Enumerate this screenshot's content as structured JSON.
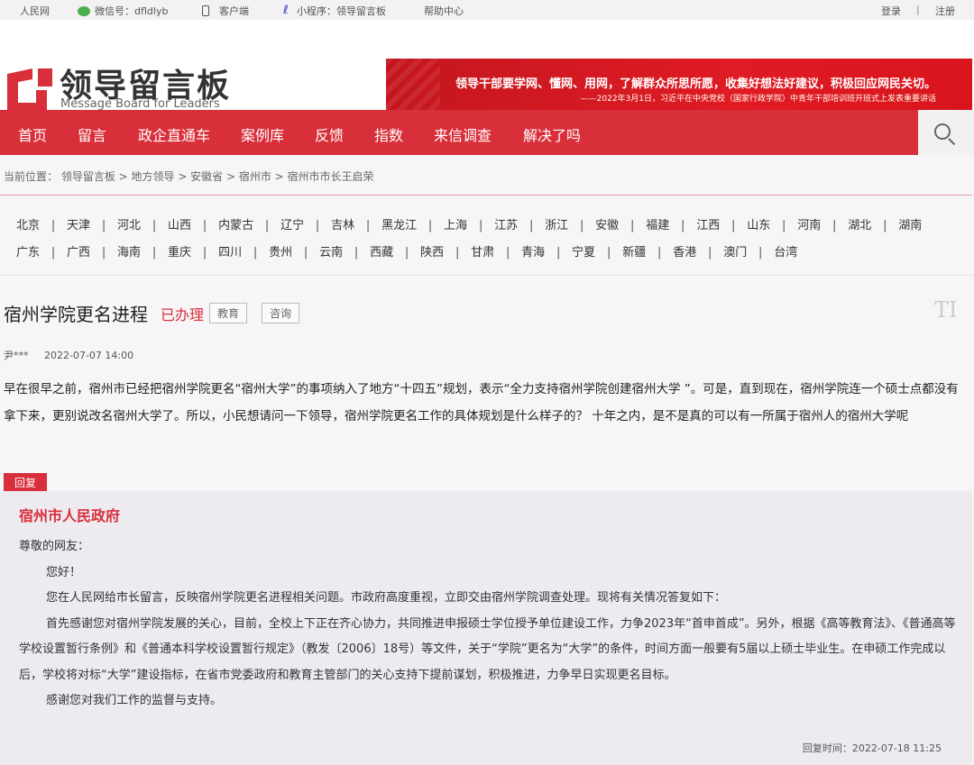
{
  "topbar": {
    "home_link": "人民网",
    "wechat_label": "微信号：dfldlyb",
    "client_label": "客户端",
    "mini_label": "小程序：领导留言板",
    "help_label": "帮助中心",
    "login": "登录",
    "separator": "|",
    "register": "注册"
  },
  "logo": {
    "cn": "领导留言板",
    "en": "Message Board for Leaders"
  },
  "banner": {
    "line1": "领导干部要学网、懂网、用网，了解群众所思所愿，收集好想法好建议，积极回应网民关切。",
    "line2": "——2022年3月1日，习近平在中央党校（国家行政学院）中青年干部培训班开班式上发表重要讲话"
  },
  "nav": {
    "items": [
      "首页",
      "留言",
      "政企直通车",
      "案例库",
      "反馈",
      "指数",
      "来信调查",
      "解决了吗"
    ]
  },
  "breadcrumb": "当前位置： 领导留言板 > 地方领导 > 安徽省 > 宿州市 > 宿州市市长王启荣",
  "regions": {
    "row1": [
      "北京",
      "天津",
      "河北",
      "山西",
      "内蒙古",
      "辽宁",
      "吉林",
      "黑龙江",
      "上海",
      "江苏",
      "浙江",
      "安徽",
      "福建",
      "江西",
      "山东",
      "河南",
      "湖北",
      "湖南"
    ],
    "row2": [
      "广东",
      "广西",
      "海南",
      "重庆",
      "四川",
      "贵州",
      "云南",
      "西藏",
      "陕西",
      "甘肃",
      "青海",
      "宁夏",
      "新疆",
      "香港",
      "澳门",
      "台湾"
    ]
  },
  "message": {
    "title": "宿州学院更名进程",
    "status": "已办理",
    "tags": [
      "教育",
      "咨询"
    ],
    "font_icon": "TI",
    "author": "尹***",
    "time": "2022-07-07 14:00",
    "content": "早在很早之前，宿州市已经把宿州学院更名“宿州大学”的事项纳入了地方“十四五”规划，表示“全力支持宿州学院创建宿州大学 ”。可是，直到现在，宿州学院连一个硕士点都没有拿下来，更别说改名宿州大学了。所以，小民想请问一下领导，宿州学院更名工作的具体规划是什么样子的？ 十年之内，是不是真的可以有一所属于宿州人的宿州大学呢"
  },
  "reply": {
    "badge": "回复",
    "org": "宿州市人民政府",
    "greeting": "尊敬的网友：",
    "p1": "您好！",
    "p2": "您在人民网给市长留言，反映宿州学院更名进程相关问题。市政府高度重视，立即交由宿州学院调查处理。现将有关情况答复如下：",
    "p3": "首先感谢您对宿州学院发展的关心，目前，全校上下正在齐心协力，共同推进申报硕士学位授予单位建设工作，力争2023年“首申首成”。另外，根据《高等教育法》、《普通高等学校设置暂行条例》和《普通本科学校设置暂行规定》（教发〔2006〕18号）等文件，关于“学院”更名为“大学”的条件，时间方面一般要有5届以上硕士毕业生。在申硕工作完成以后，学校将对标“大学”建设指标，在省市党委政府和教育主管部门的关心支持下提前谋划，积极推进，力争早日实现更名目标。",
    "p4": "感谢您对我们工作的监督与支持。",
    "time": "回复时间：2022-07-18 11:25"
  },
  "colors": {
    "brand_red": "#d92f3a",
    "banner_red": "#e01b24"
  }
}
